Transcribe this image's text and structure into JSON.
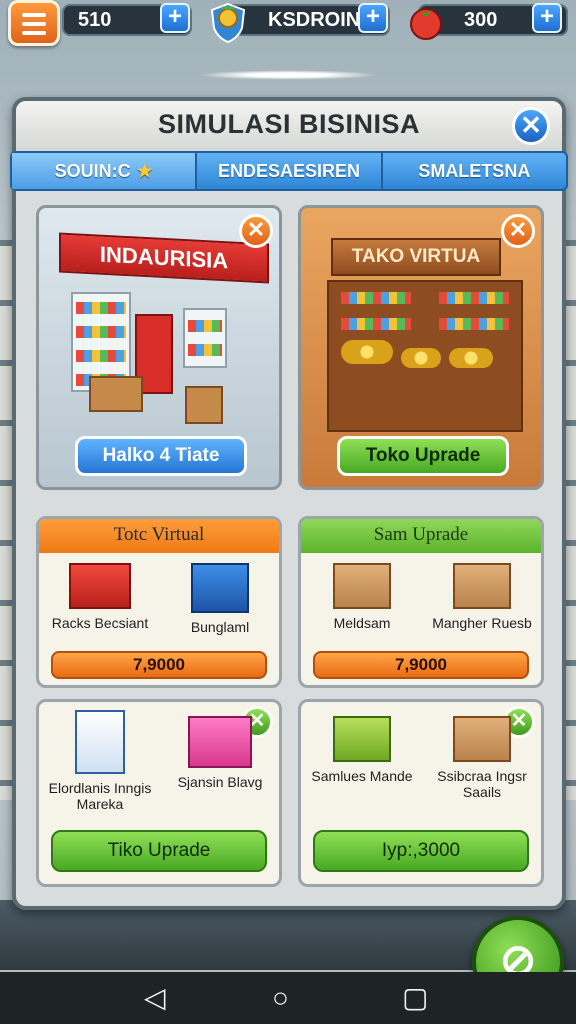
{
  "resources": [
    {
      "value": "510",
      "icon": "resource-icon"
    },
    {
      "value": "KSDROIN",
      "icon": "shield-emblem-icon"
    },
    {
      "value": "300",
      "icon": "tomato-icon"
    }
  ],
  "panel": {
    "title": "SIMULASI BISINISA",
    "tabs": [
      {
        "label": "SOUIN:C",
        "active": true
      },
      {
        "label": "ENDESAESIREN",
        "active": false
      },
      {
        "label": "SMALETSNA",
        "active": false
      }
    ]
  },
  "stores": [
    {
      "sign": "INDAURISIA",
      "button": "Halko 4 Tiate"
    },
    {
      "sign": "TAKO VIRTUA",
      "button": "Toko Uprade"
    }
  ],
  "upgrade_cards": [
    {
      "header": "Totc Virtual",
      "items": [
        "Racks Becsiant",
        "Bunglaml"
      ],
      "price": "7,9000"
    },
    {
      "header": "Sam Uprade",
      "items": [
        "Meldsam",
        "Mangher Ruesb"
      ],
      "price": "7,9000"
    },
    {
      "items": [
        "Elordlanis Inngis Mareka",
        "Sjansin Blavg"
      ],
      "button": "Tiko Uprade"
    },
    {
      "items": [
        "Samlues Mande",
        "Ssibcraa Ingsr Saails"
      ],
      "button": "Iyp:,3000"
    }
  ],
  "colors": {
    "accent_blue": "#2f86d6",
    "accent_orange": "#ef7a16",
    "accent_green": "#49a824"
  }
}
